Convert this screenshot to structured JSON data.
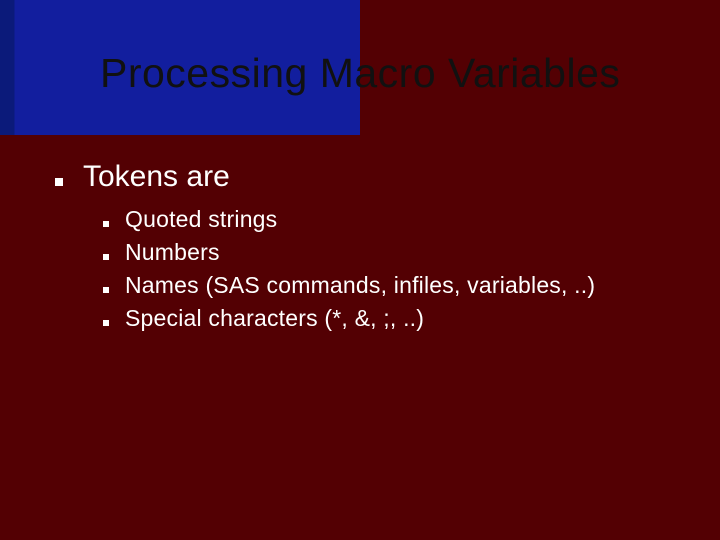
{
  "title": "Processing Macro Variables",
  "bullets": [
    {
      "text": "Tokens are",
      "subs": [
        "Quoted strings",
        "Numbers",
        "Names (SAS commands, infiles, variables, ..)",
        "Special characters (*, &, ;, ..)"
      ]
    }
  ]
}
